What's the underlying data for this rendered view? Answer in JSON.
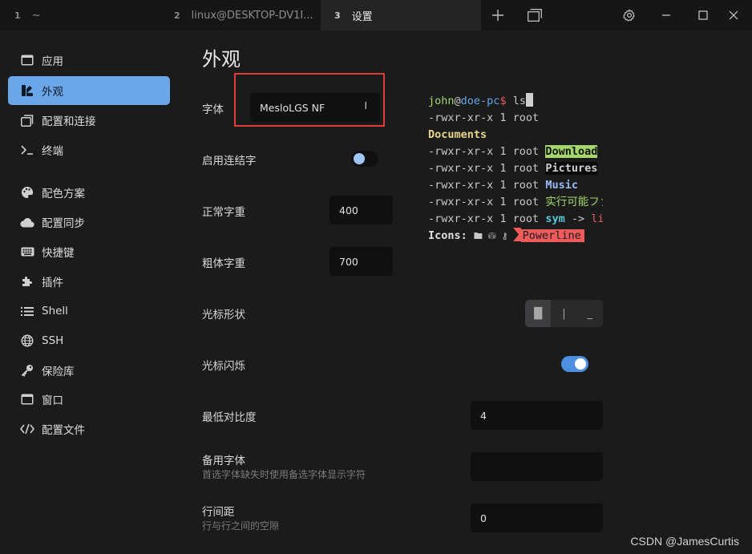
{
  "tabs": [
    {
      "num": "1",
      "label": "~"
    },
    {
      "num": "2",
      "label": "linux@DESKTOP-DV1I..."
    },
    {
      "num": "3",
      "label": "设置"
    }
  ],
  "sidebar": {
    "items": [
      {
        "label": "应用",
        "icon": "window-icon"
      },
      {
        "label": "外观",
        "icon": "paint-icon"
      },
      {
        "label": "配置和连接",
        "icon": "profiles-icon"
      },
      {
        "label": "终端",
        "icon": "terminal-icon"
      },
      {
        "label": "配色方案",
        "icon": "palette-icon"
      },
      {
        "label": "配置同步",
        "icon": "cloud-icon"
      },
      {
        "label": "快捷键",
        "icon": "keyboard-icon"
      },
      {
        "label": "插件",
        "icon": "puzzle-icon"
      },
      {
        "label": "Shell",
        "icon": "list-icon"
      },
      {
        "label": "SSH",
        "icon": "globe-icon"
      },
      {
        "label": "保险库",
        "icon": "key-icon"
      },
      {
        "label": "窗口",
        "icon": "window-icon"
      },
      {
        "label": "配置文件",
        "icon": "code-icon"
      }
    ],
    "active_index": 1
  },
  "main": {
    "title": "外观",
    "font": {
      "label": "字体",
      "value": "MesloLGS NF"
    },
    "ligatures": {
      "label": "启用连结字",
      "enabled": false
    },
    "normal_weight": {
      "label": "正常字重",
      "value": "400"
    },
    "bold_weight": {
      "label": "粗体字重",
      "value": "700"
    },
    "cursor_shape": {
      "label": "光标形状",
      "options": [
        "█",
        "|",
        "_"
      ],
      "selected": 0
    },
    "cursor_blink": {
      "label": "光标闪烁",
      "enabled": true
    },
    "min_contrast": {
      "label": "最低对比度",
      "value": "4"
    },
    "fallback_font": {
      "label": "备用字体",
      "description": "首选字体缺失时使用备选字体显示字符",
      "value": ""
    },
    "line_height": {
      "label": "行间距",
      "description": "行与行之间的空隙",
      "value": "0"
    }
  },
  "preview": {
    "user": "john",
    "at": "@",
    "host": "doe-pc",
    "dollar": "$",
    "command": " ls",
    "perm": "-rwxr-xr-x 1 root ",
    "documents": "Documents",
    "download": "Download",
    "pictures": "Pictures",
    "music": "Music",
    "executable": "实行可能ファイル",
    "sym": "sym",
    "arrow": " -> ",
    "link_target": "link",
    "icons_label": "Icons: ",
    "icons_glyphs": "🖿 ⛁ ⚷",
    "powerline": "Powerline"
  },
  "colors": {
    "accent": "#6ba6e8",
    "highlight_box": "#e23b3b",
    "toggle_on": "#4d8fe0"
  },
  "watermark": "CSDN @JamesCurtis"
}
